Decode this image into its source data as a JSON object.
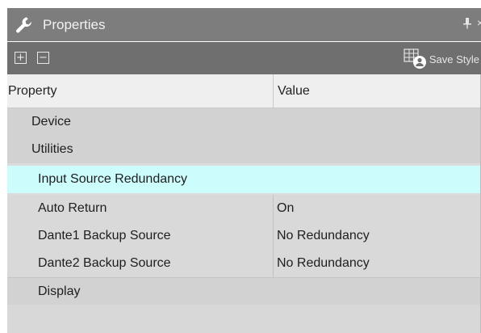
{
  "window": {
    "title": "Properties",
    "pin_glyph": "ᚐ",
    "close_glyph": "×"
  },
  "toolbar": {
    "expand_label": "+",
    "collapse_label": "−",
    "save_style_label": "Save Style"
  },
  "table": {
    "columns": [
      "Property",
      "Value"
    ],
    "rows": [
      {
        "type": "category",
        "property": "Device",
        "value": ""
      },
      {
        "type": "category",
        "property": "Utilities",
        "value": ""
      },
      {
        "type": "category-selected",
        "property": "Input Source Redundancy",
        "value": ""
      },
      {
        "type": "property",
        "property": "Auto Return",
        "value": "On"
      },
      {
        "type": "property",
        "property": "Dante1 Backup Source",
        "value": "No Redundancy"
      },
      {
        "type": "property",
        "property": "Dante2 Backup Source",
        "value": "No Redundancy"
      },
      {
        "type": "category",
        "property": "Display",
        "value": ""
      }
    ]
  },
  "colors": {
    "titlebar": "#7d7d7d",
    "toolbar": "#6f6f6f",
    "selected_row": "#ccfcfc",
    "category_row": "#d2d2d2"
  },
  "icons": {
    "title": "wrench-icon",
    "expand": "plus-box-icon",
    "collapse": "minus-box-icon",
    "save_style": "grid-user-icon",
    "pin": "pin-icon",
    "close": "close-icon"
  }
}
